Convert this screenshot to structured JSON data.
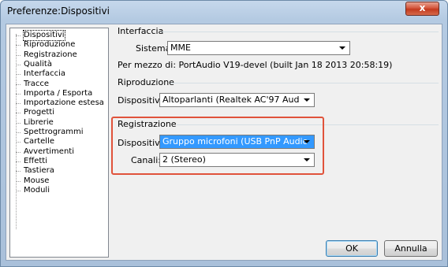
{
  "window": {
    "title": "Preferenze:Dispositivi",
    "close_label": "x"
  },
  "tree": {
    "items": [
      {
        "label": "Dispositivi",
        "selected": true
      },
      {
        "label": "Riproduzione"
      },
      {
        "label": "Registrazione"
      },
      {
        "label": "Qualità"
      },
      {
        "label": "Interfaccia"
      },
      {
        "label": "Tracce"
      },
      {
        "label": "Importa / Esporta"
      },
      {
        "label": "Importazione estesa"
      },
      {
        "label": "Progetti"
      },
      {
        "label": "Librerie"
      },
      {
        "label": "Spettrogrammi"
      },
      {
        "label": "Cartelle"
      },
      {
        "label": "Avvertimenti"
      },
      {
        "label": "Effetti"
      },
      {
        "label": "Tastiera"
      },
      {
        "label": "Mouse"
      },
      {
        "label": "Moduli"
      }
    ]
  },
  "interfaccia": {
    "title": "Interfaccia",
    "host_label": "Sistema:",
    "host_value": "MME",
    "info": "Per mezzo di: PortAudio V19-devel (built Jan 18 2013 20:58:19)"
  },
  "riproduzione": {
    "title": "Riproduzione",
    "device_label": "Dispositivi:",
    "device_value": "Altoparlanti (Realtek AC'97 Aud"
  },
  "registrazione": {
    "title": "Registrazione",
    "device_label": "Dispositivi:",
    "device_value": "Gruppo microfoni (USB PnP Audio",
    "channels_label": "Canali:",
    "channels_value": "2 (Stereo)"
  },
  "buttons": {
    "ok": "OK",
    "cancel": "Annulla"
  },
  "colors": {
    "highlight_border": "#e0533b",
    "focused_combo": "#3399ff"
  }
}
